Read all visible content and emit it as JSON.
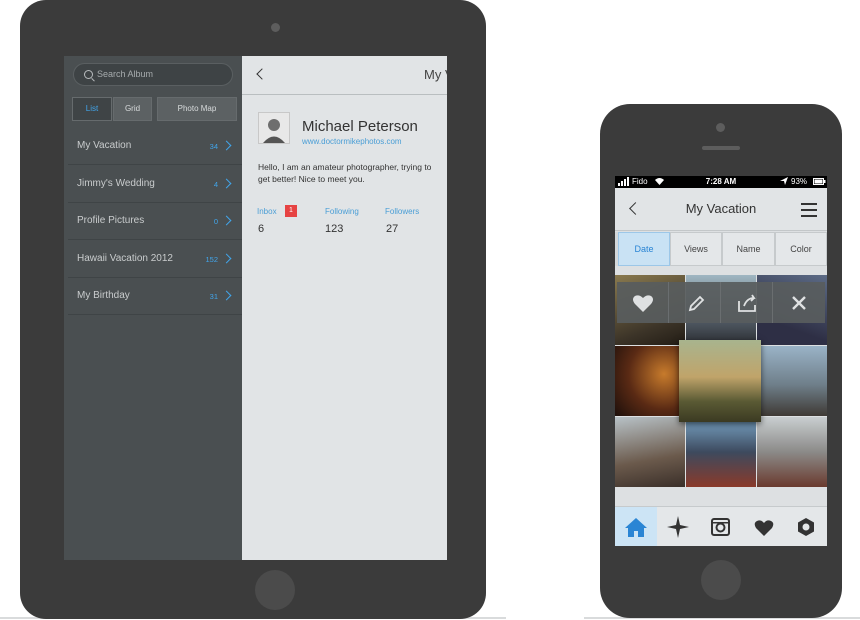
{
  "tablet": {
    "search_placeholder": "Search Album",
    "view_tabs": [
      "List",
      "Grid",
      "Photo Map"
    ],
    "albums": [
      {
        "name": "My Vacation",
        "count": "34"
      },
      {
        "name": "Jimmy's Wedding",
        "count": "4"
      },
      {
        "name": "Profile Pictures",
        "count": "0"
      },
      {
        "name": "Hawaii Vacation 2012",
        "count": "152"
      },
      {
        "name": "My Birthday",
        "count": "31"
      }
    ],
    "panel_title": "My V",
    "profile": {
      "name": "Michael Peterson",
      "website": "www.doctormikephotos.com",
      "bio": "Hello, I am an amateur photographer, trying to get better! Nice to meet you.",
      "inbox_label": "Inbox",
      "inbox_badge": "1",
      "inbox_value": "6",
      "following_label": "Following",
      "following_value": "123",
      "followers_label": "Followers",
      "followers_value": "27"
    }
  },
  "phone": {
    "status": {
      "carrier": "Fido",
      "time": "7:28 AM",
      "battery": "93%"
    },
    "title": "My Vacation",
    "sort_tabs": [
      "Date",
      "Views",
      "Name",
      "Color"
    ],
    "actions": [
      "heart-icon",
      "pencil-icon",
      "share-icon",
      "close-icon"
    ],
    "tabbar": [
      "home-icon",
      "explore-icon",
      "camera-icon",
      "favorites-icon",
      "settings-icon"
    ]
  },
  "colors": {
    "accent": "#41a5ea",
    "badge": "#e64343",
    "device": "#3b3b3b",
    "sidebar": "#4a4f51"
  }
}
